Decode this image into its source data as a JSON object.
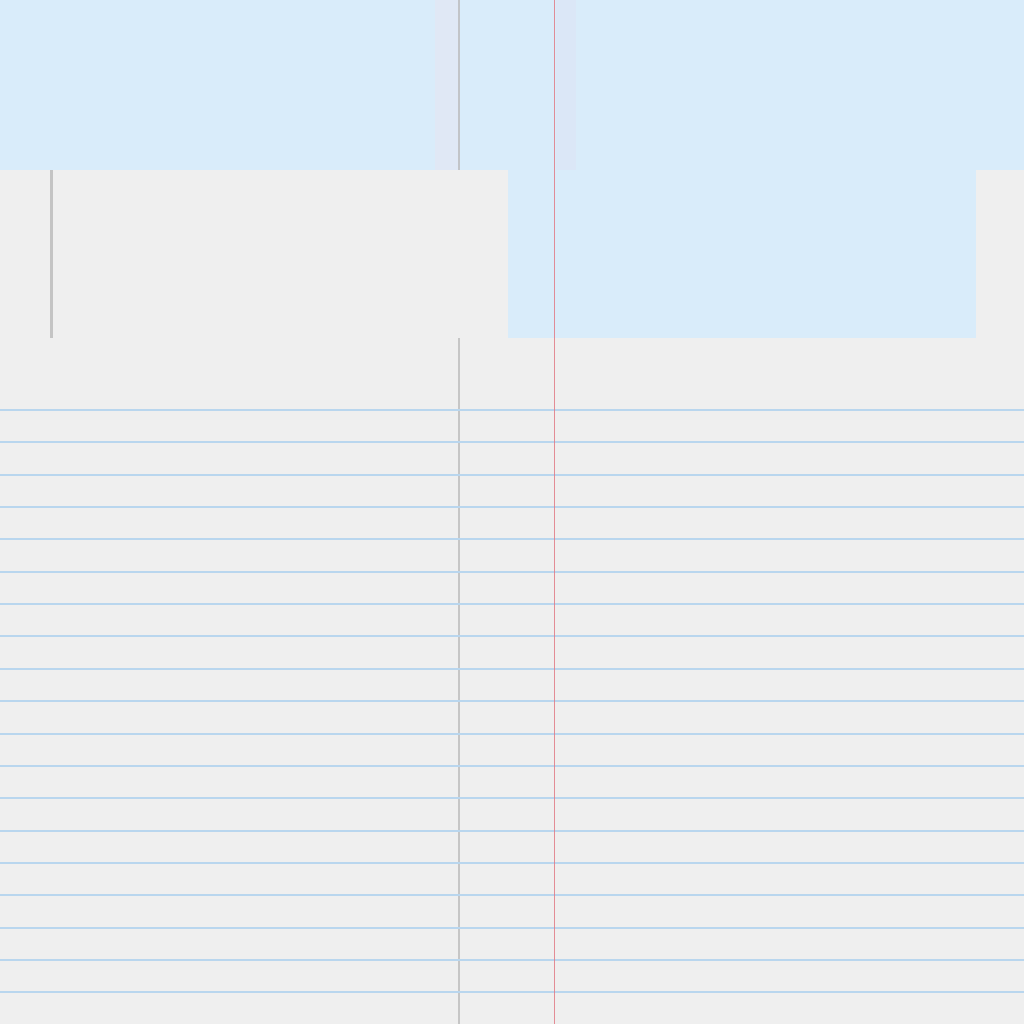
{
  "colors": {
    "paper": "#efefef",
    "highlight": "#d9ecfa",
    "rule_line": "#b9d6ee",
    "margin_red": "#e07a85",
    "binding_gray": "#c6c6c6"
  },
  "ruled_lines": {
    "count": 19
  }
}
